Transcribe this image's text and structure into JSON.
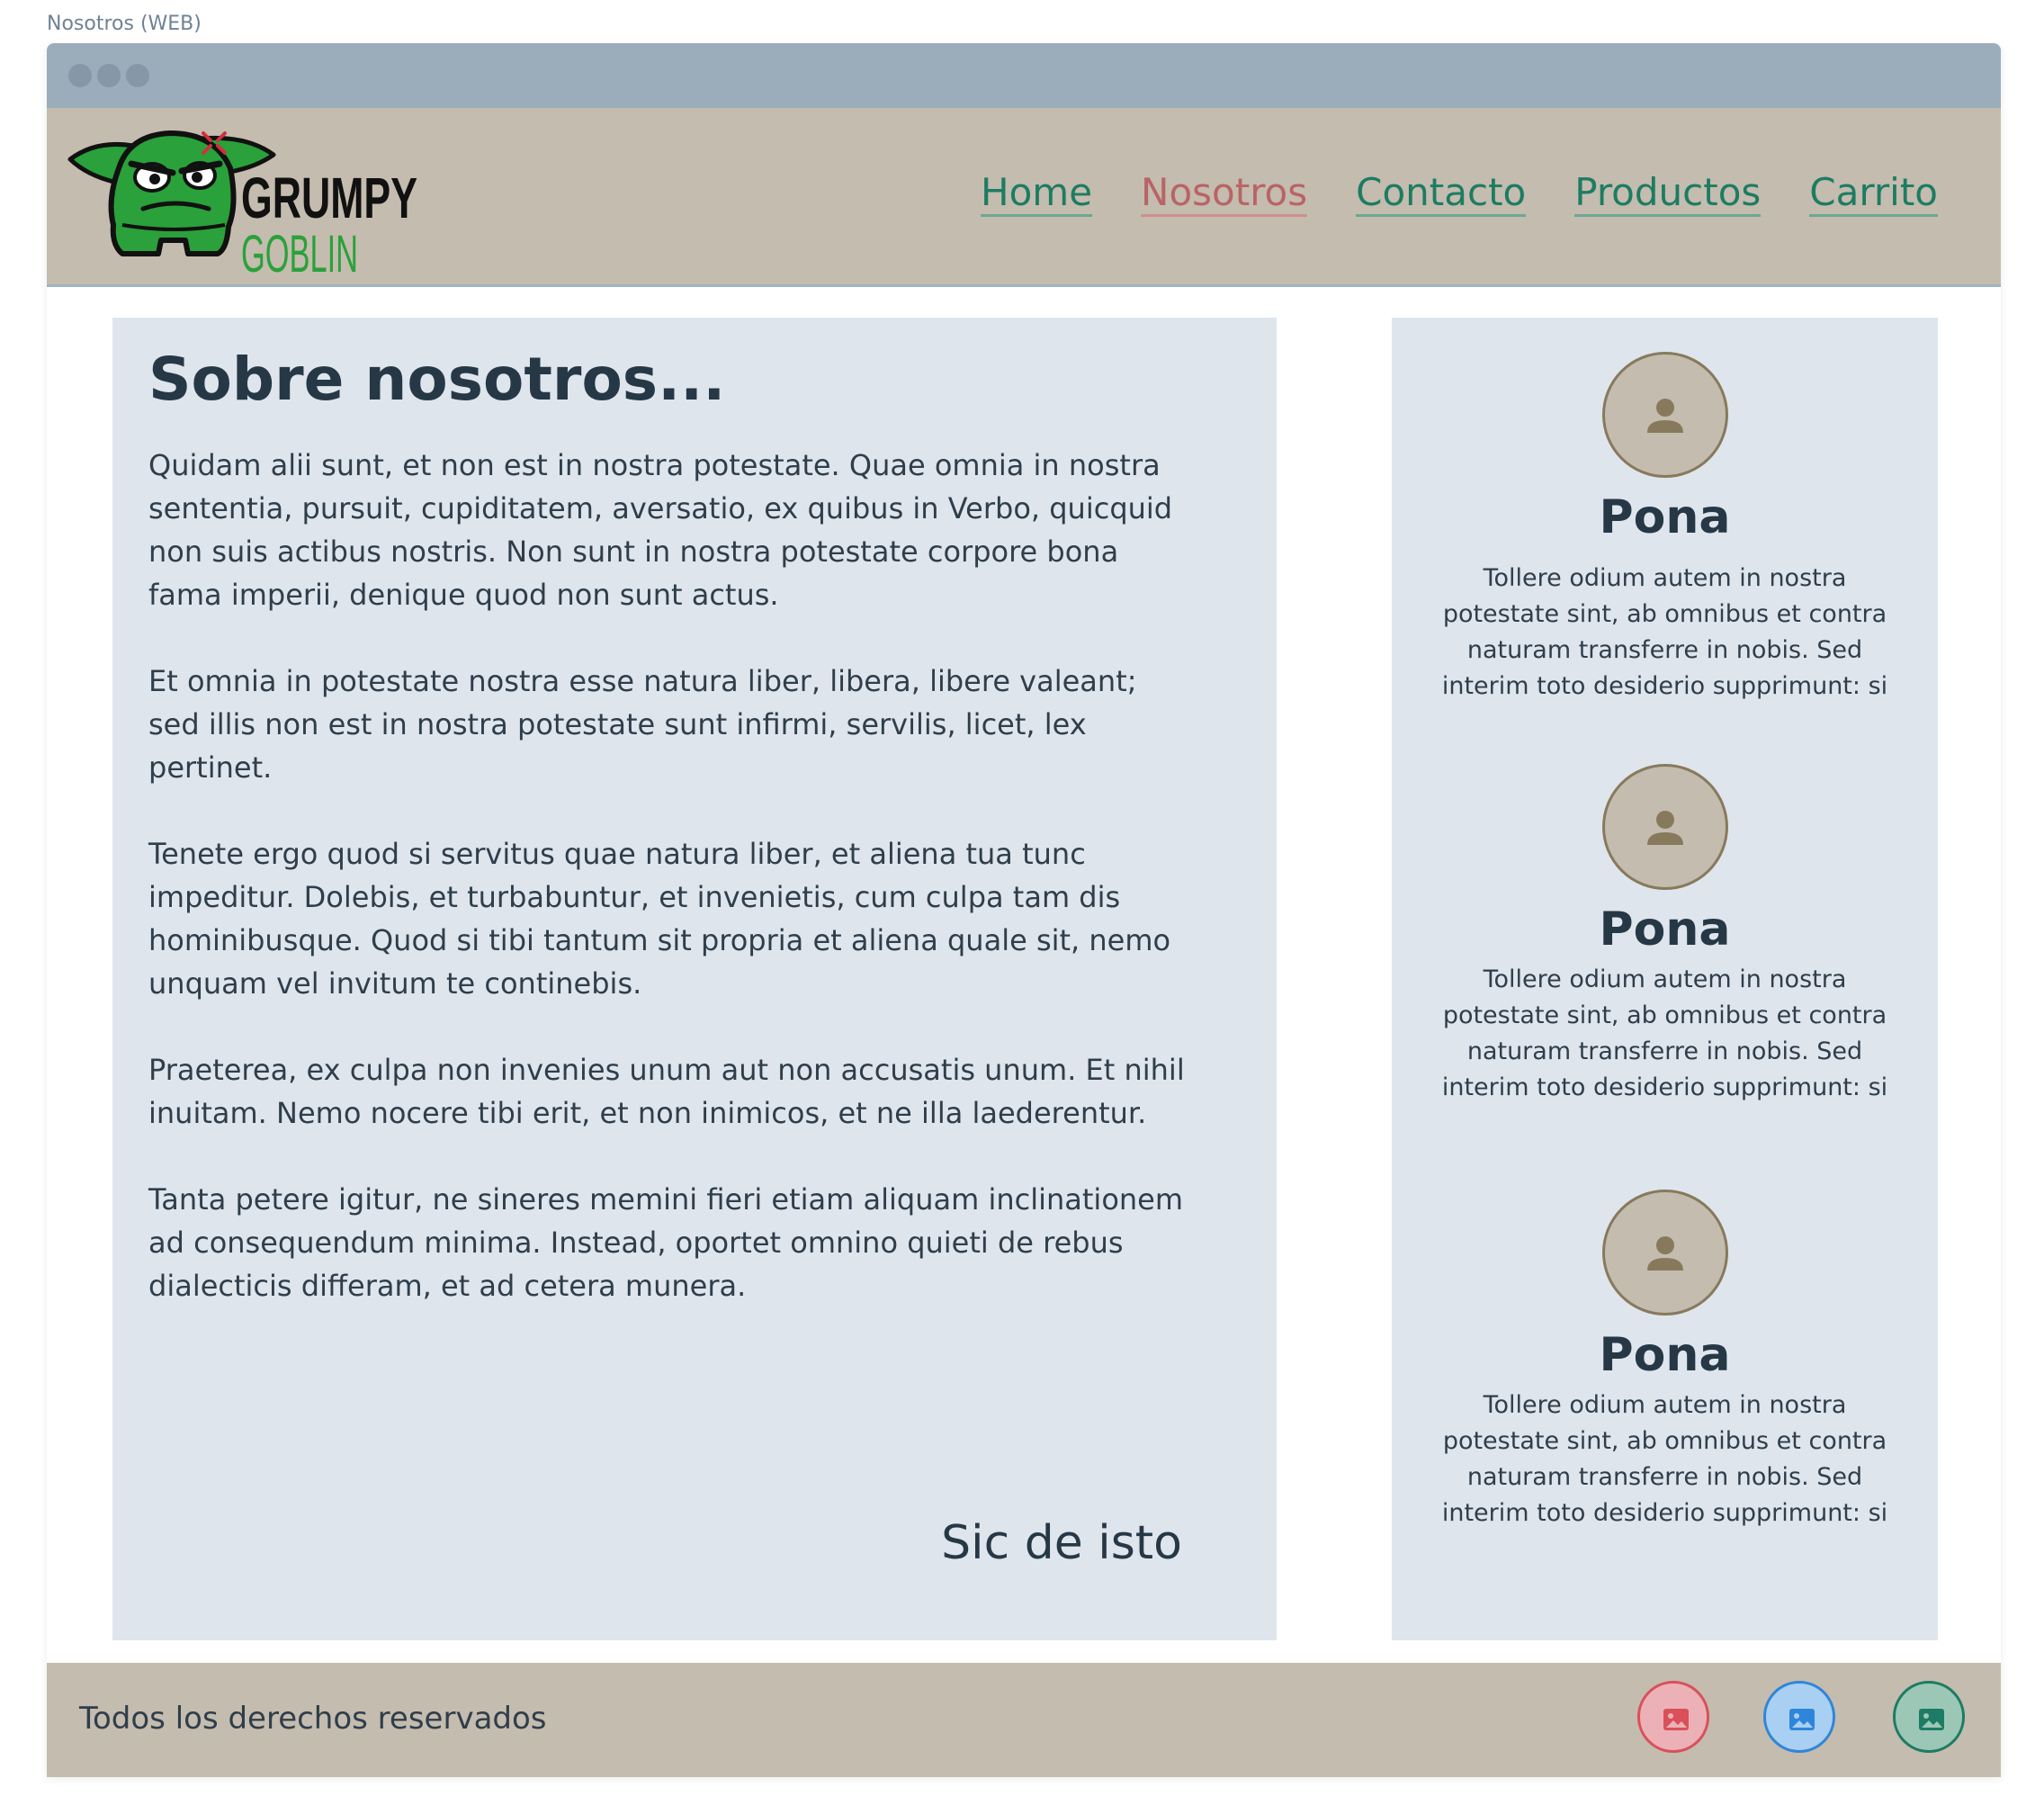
{
  "frame": {
    "title": "Nosotros (WEB)"
  },
  "logo": {
    "line1": "GRUMPY",
    "line2": "GOBLIN"
  },
  "nav": {
    "items": [
      {
        "label": "Home"
      },
      {
        "label": "Nosotros"
      },
      {
        "label": "Contacto"
      },
      {
        "label": "Productos"
      },
      {
        "label": "Carrito"
      }
    ],
    "active": "Nosotros"
  },
  "about": {
    "title": "Sobre nosotros...",
    "paragraphs": [
      "Quidam alii sunt, et non est in nostra potestate. Quae omnia in nostra sententia, pursuit, cupiditatem, aversatio, ex quibus in Verbo, quicquid non suis actibus nostris. Non sunt in nostra potestate corpore bona fama imperii, denique quod non sunt actus.",
      "Et omnia in potestate nostra esse natura liber, libera, libere valeant; sed illis non est in nostra potestate sunt infirmi, servilis, licet, lex pertinet.",
      "Tenete ergo quod si servitus quae natura liber, et aliena tua tunc impeditur. Dolebis, et turbabuntur, et invenietis, cum culpa tam dis hominibusque. Quod si tibi tantum sit propria et aliena quale sit, nemo unquam vel invitum te continebis.",
      "Praeterea, ex culpa non invenies unum aut non accusatis unum. Et nihil inuitam. Nemo nocere tibi erit, et non inimicos, et ne illa laederentur.",
      "Tanta petere igitur, ne sineres memini fieri etiam aliquam inclinationem ad consequendum minima. Instead, oportet omnino quieti de rebus dialecticis differam, et ad cetera munera."
    ],
    "signature": "Sic de isto"
  },
  "team": [
    {
      "name": "Pona",
      "bio": "Tollere odium autem in nostra potestate sint, ab omnibus et contra naturam transferre in nobis. Sed interim toto desiderio supprimunt: si"
    },
    {
      "name": "Pona",
      "bio": "Tollere odium autem in nostra potestate sint, ab omnibus et contra naturam transferre in nobis. Sed interim toto desiderio supprimunt: si"
    },
    {
      "name": "Pona",
      "bio": "Tollere odium autem in nostra potestate sint, ab omnibus et contra naturam transferre in nobis. Sed interim toto desiderio supprimunt: si"
    }
  ],
  "footer": {
    "copyright": "Todos los derechos reservados",
    "social_icons": [
      {
        "icon": "image-icon",
        "color": "#d9505a"
      },
      {
        "icon": "image-icon",
        "color": "#2f86d8"
      },
      {
        "icon": "image-icon",
        "color": "#1d7c63"
      }
    ]
  },
  "colors": {
    "nav_link": "#1d7c63",
    "nav_active": "#b86466",
    "chrome": "#9badbb",
    "navbar": "#c4bcae",
    "card": "#dfe5ed"
  }
}
